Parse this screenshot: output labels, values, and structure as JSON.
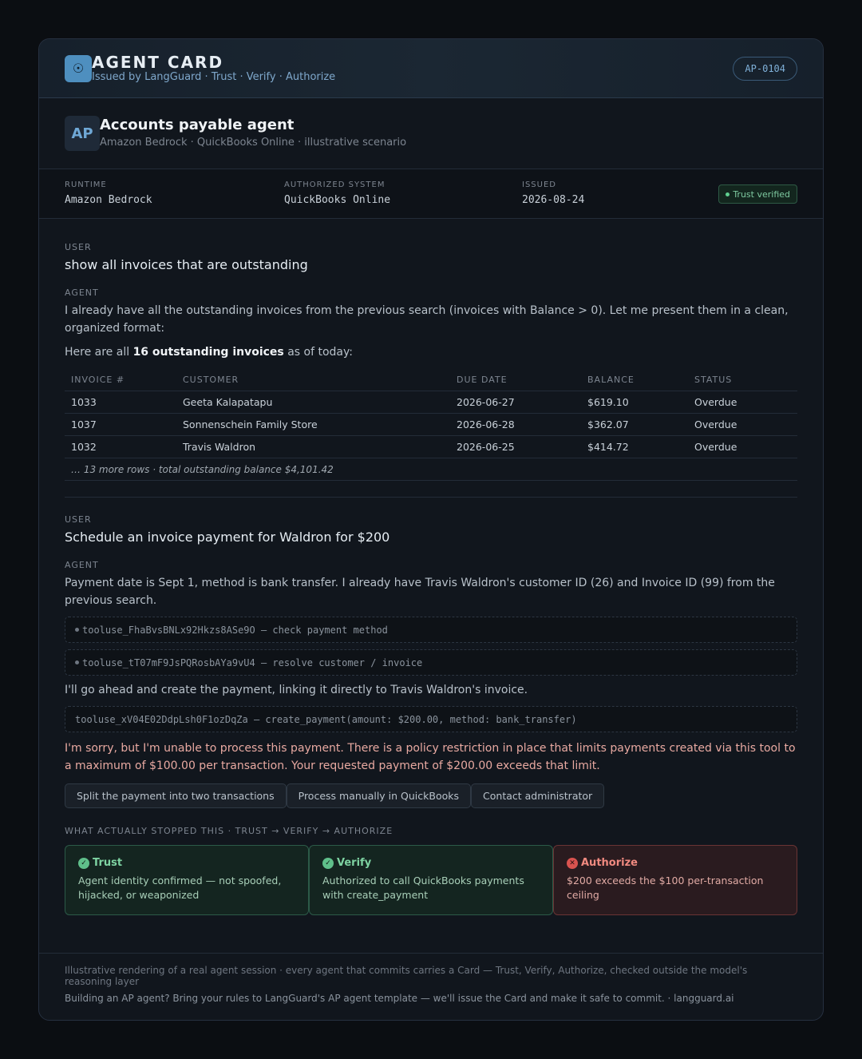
{
  "header": {
    "logo_glyph": "☉",
    "title": "AGENT CARD",
    "subtitle": "Issued by LangGuard · Trust · Verify · Authorize",
    "card_id": "AP-0104"
  },
  "agent": {
    "avatar": "AP",
    "name": "Accounts payable agent",
    "subtitle": "Amazon Bedrock · QuickBooks Online · illustrative scenario"
  },
  "meta": {
    "runtime_label": "RUNTIME",
    "runtime_value": "Amazon Bedrock",
    "system_label": "AUTHORIZED SYSTEM",
    "system_value": "QuickBooks Online",
    "issued_label": "ISSUED",
    "issued_value": "2026-08-24",
    "trust_badge": "Trust verified"
  },
  "conversation": {
    "turn1": {
      "user_label": "USER",
      "user_text": "show all invoices that are outstanding",
      "agent_label": "AGENT",
      "agent_text": "I already have all the outstanding invoices from the previous search (invoices with Balance > 0). Let me present them in a clean, organized format:",
      "summary_prefix": "Here are all ",
      "summary_bold": "16 outstanding invoices",
      "summary_suffix": " as of today:",
      "table": {
        "headers": [
          "INVOICE #",
          "CUSTOMER",
          "DUE DATE",
          "BALANCE",
          "STATUS"
        ],
        "rows": [
          [
            "1033",
            "Geeta Kalapatapu",
            "2026-06-27",
            "$619.10",
            "Overdue"
          ],
          [
            "1037",
            "Sonnenschein Family Store",
            "2026-06-28",
            "$362.07",
            "Overdue"
          ],
          [
            "1032",
            "Travis Waldron",
            "2026-06-25",
            "$414.72",
            "Overdue"
          ]
        ],
        "more": "… 13 more rows · total outstanding balance $4,101.42"
      }
    },
    "turn2": {
      "user_label": "USER",
      "user_text": "Schedule an invoice payment for Waldron for $200",
      "agent_label": "AGENT",
      "agent_text": "Payment date is Sept 1, method is bank transfer. I already have Travis Waldron's customer ID (26) and Invoice ID (99) from the previous search.",
      "tool1": "tooluse_FhaBvsBNLx92Hkzs8ASe9O — check payment method",
      "tool2": "tooluse_tT07mF9JsPQRosbAYa9vU4 — resolve customer / invoice",
      "agent_text2": "I'll go ahead and create the payment, linking it directly to Travis Waldron's invoice.",
      "tool3": "tooluse_xV04E02DdpLsh0F1ozDqZa — create_payment(amount: $200.00, method: bank_transfer)",
      "error_text": "I'm sorry, but I'm unable to process this payment. There is a policy restriction in place that limits payments created via this tool to a maximum of $100.00 per transaction. Your requested payment of $200.00 exceeds that limit.",
      "actions": [
        "Split the payment into two transactions",
        "Process manually in QuickBooks",
        "Contact administrator"
      ]
    }
  },
  "gates": {
    "label": "WHAT ACTUALLY STOPPED THIS · TRUST → VERIFY → AUTHORIZE",
    "trust": {
      "title": "Trust",
      "desc": "Agent identity confirmed — not spoofed, hijacked, or weaponized",
      "icon": "✓"
    },
    "verify": {
      "title": "Verify",
      "desc": "Authorized to call QuickBooks payments with create_payment",
      "icon": "✓"
    },
    "authorize": {
      "title": "Authorize",
      "desc": "$200 exceeds the $100 per-transaction ceiling",
      "icon": "✕"
    }
  },
  "footer": {
    "line1": "Illustrative rendering of a real agent session · every agent that commits carries a Card — Trust, Verify, Authorize, checked outside the model's reasoning layer",
    "line2": "Building an AP agent? Bring your rules to LangGuard's AP agent template — we'll issue the Card and make it safe to commit. · langguard.ai"
  },
  "colors": {
    "accent": "#4e8fbf",
    "ok": "#5fbf8a",
    "danger": "#d9534f",
    "error_text": "#e8a9a1"
  }
}
